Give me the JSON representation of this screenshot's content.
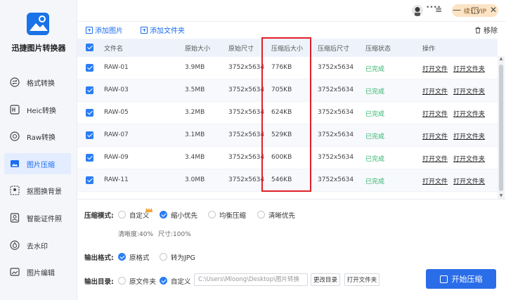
{
  "app": {
    "name": "迅捷图片转换器"
  },
  "sidebar": {
    "items": [
      {
        "label": "格式转换",
        "icon": "format-convert-icon"
      },
      {
        "label": "Heic转换",
        "icon": "heic-icon"
      },
      {
        "label": "Raw转换",
        "icon": "raw-icon"
      },
      {
        "label": "图片压缩",
        "icon": "image-compress-icon",
        "active": true
      },
      {
        "label": "抠图换背景",
        "icon": "cutout-icon"
      },
      {
        "label": "智能证件照",
        "icon": "id-photo-icon"
      },
      {
        "label": "去水印",
        "icon": "watermark-icon"
      },
      {
        "label": "图片编辑",
        "icon": "image-edit-icon"
      }
    ]
  },
  "topbar": {
    "username": "••••",
    "vip_label": "续订VIP",
    "menu_icon": "≡",
    "minimize_icon": "—",
    "maximize_icon": "□",
    "close_icon": "✕"
  },
  "toolbar": {
    "add_image": "添加图片",
    "add_folder": "添加文件夹",
    "remove": "移除"
  },
  "table": {
    "headers": [
      "文件名",
      "原始大小",
      "原始尺寸",
      "压缩后大小",
      "压缩后尺寸",
      "压缩状态",
      "操作"
    ],
    "rows": [
      {
        "name": "RAW-01",
        "orig_size": "3.9MB",
        "orig_dim": "3752x5634",
        "new_size": "776KB",
        "new_dim": "3752x5634",
        "status": "已完成"
      },
      {
        "name": "RAW-03",
        "orig_size": "3.5MB",
        "orig_dim": "3752x5634",
        "new_size": "705KB",
        "new_dim": "3752x5634",
        "status": "已完成"
      },
      {
        "name": "RAW-05",
        "orig_size": "3.2MB",
        "orig_dim": "3752x5634",
        "new_size": "624KB",
        "new_dim": "3752x5634",
        "status": "已完成"
      },
      {
        "name": "RAW-07",
        "orig_size": "3.1MB",
        "orig_dim": "3752x5634",
        "new_size": "529KB",
        "new_dim": "3752x5634",
        "status": "已完成"
      },
      {
        "name": "RAW-09",
        "orig_size": "3.4MB",
        "orig_dim": "3752x5634",
        "new_size": "600KB",
        "new_dim": "3752x5634",
        "status": "已完成"
      },
      {
        "name": "RAW-11",
        "orig_size": "3.0MB",
        "orig_dim": "3752x5634",
        "new_size": "546KB",
        "new_dim": "3752x5634",
        "status": "已完成"
      }
    ],
    "action_open_file": "打开文件",
    "action_open_folder": "打开文件夹"
  },
  "settings": {
    "mode_label": "压缩模式:",
    "modes": [
      {
        "label": "自定义",
        "selected": false
      },
      {
        "label": "缩小优先",
        "selected": true
      },
      {
        "label": "均衡压缩",
        "selected": false
      },
      {
        "label": "清晰优先",
        "selected": false
      }
    ],
    "clarity": "清晰度:40%",
    "size": "尺寸:100%",
    "format_label": "输出格式:",
    "formats": [
      {
        "label": "原格式",
        "selected": true
      },
      {
        "label": "转为JPG",
        "selected": false
      }
    ],
    "dir_label": "输出目录:",
    "dirs": [
      {
        "label": "原文件夹",
        "selected": false
      },
      {
        "label": "自定义",
        "selected": true
      }
    ],
    "dir_path": "C:\\Users\\Mloong\\Desktop\\图片转换",
    "change_dir": "更改目录",
    "open_folder": "打开文件夹",
    "start": "开始压缩"
  },
  "colors": {
    "accent": "#2a6de8",
    "success": "#2fb46c",
    "highlight": "#e0202a",
    "vip_bg": "#fbe3c4"
  }
}
